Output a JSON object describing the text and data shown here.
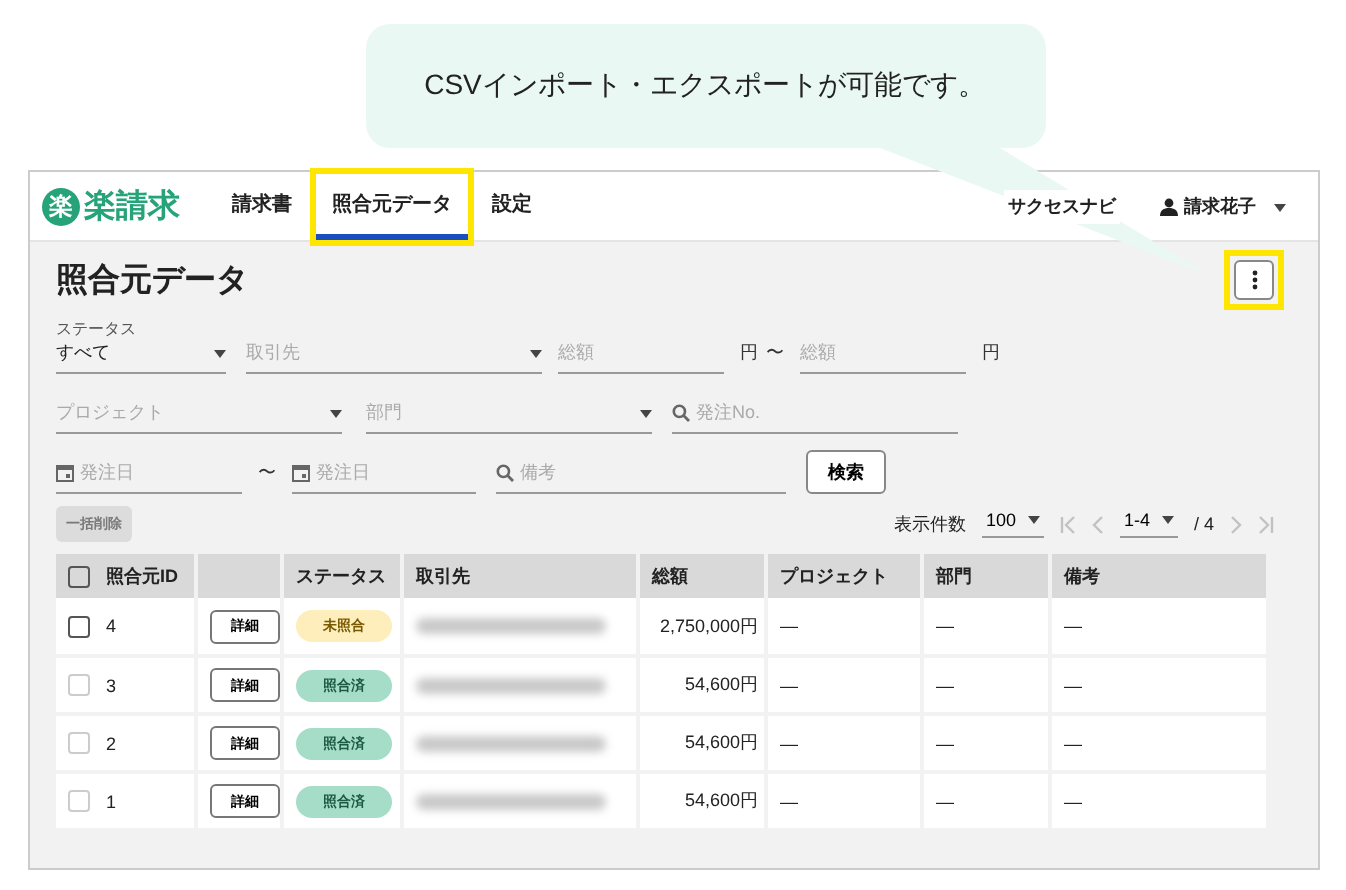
{
  "callout": {
    "text": "CSVインポート・エクスポートが可能です。"
  },
  "header": {
    "logo_mark": "楽",
    "logo_text": "楽請求",
    "nav": [
      {
        "label": "請求書",
        "selected": false,
        "highlighted": false
      },
      {
        "label": "照合元データ",
        "selected": true,
        "highlighted": true
      },
      {
        "label": "設定",
        "selected": false,
        "highlighted": false
      }
    ],
    "help_link": "サクセスナビ",
    "user": "請求花子"
  },
  "page": {
    "title": "照合元データ",
    "menu_highlighted": true
  },
  "filters": {
    "status_label": "ステータス",
    "status_value": "すべて",
    "client": "取引先",
    "total_from": "総額",
    "yen_1": "円",
    "tilde_1": "〜",
    "total_to": "総額",
    "yen_2": "円",
    "project": "プロジェクト",
    "department": "部門",
    "order_no": "発注No.",
    "date_from": "発注日",
    "tilde_2": "〜",
    "date_to": "発注日",
    "note": "備考",
    "search_button": "検索"
  },
  "bulk_delete": {
    "label": "一括削除",
    "disabled": true
  },
  "pagination": {
    "per_page_label": "表示件数",
    "per_page": "100",
    "range": "1-4",
    "total": "/ 4"
  },
  "table": {
    "select_all_checked": false,
    "columns": [
      {
        "kind": "id",
        "label": "照合元ID"
      },
      {
        "kind": "blank"
      },
      {
        "kind": "text",
        "label": "ステータス"
      },
      {
        "kind": "text",
        "label": "取引先"
      },
      {
        "kind": "text",
        "label": "総額"
      },
      {
        "kind": "text",
        "label": "プロジェクト"
      },
      {
        "kind": "text",
        "label": "部門"
      },
      {
        "kind": "text",
        "label": "備考"
      }
    ],
    "rows": [
      {
        "id": "4",
        "checkbox_disabled": false,
        "detail": "詳細",
        "status": {
          "label": "未照合",
          "kind": "unmatched"
        },
        "total": "2,750,000円",
        "project": "—",
        "department": "—",
        "note": "—"
      },
      {
        "id": "3",
        "checkbox_disabled": true,
        "detail": "詳細",
        "status": {
          "label": "照合済",
          "kind": "matched"
        },
        "total": "54,600円",
        "project": "—",
        "department": "—",
        "note": "—"
      },
      {
        "id": "2",
        "checkbox_disabled": true,
        "detail": "詳細",
        "status": {
          "label": "照合済",
          "kind": "matched"
        },
        "total": "54,600円",
        "project": "—",
        "department": "—",
        "note": "—"
      },
      {
        "id": "1",
        "checkbox_disabled": true,
        "detail": "詳細",
        "status": {
          "label": "照合済",
          "kind": "matched"
        },
        "total": "54,600円",
        "project": "—",
        "department": "—",
        "note": "—"
      }
    ]
  }
}
